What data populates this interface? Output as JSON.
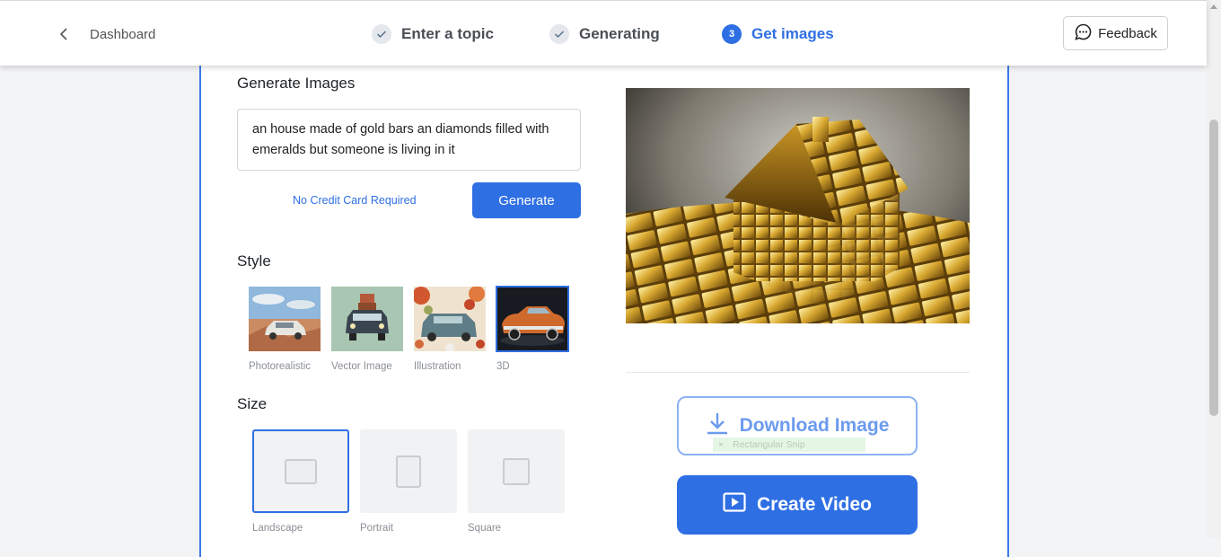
{
  "header": {
    "back_label": "Dashboard",
    "steps": [
      {
        "label": "Enter a topic",
        "state": "done"
      },
      {
        "label": "Generating",
        "state": "done"
      },
      {
        "label": "Get images",
        "number": "3",
        "state": "active"
      }
    ],
    "feedback_label": "Feedback"
  },
  "generate": {
    "title": "Generate Images",
    "prompt": "an house made of gold bars an diamonds filled with emeralds but someone is living in it",
    "no_credit_card": "No Credit Card Required",
    "button_label": "Generate"
  },
  "style": {
    "title": "Style",
    "options": [
      {
        "label": "Photorealistic",
        "selected": false
      },
      {
        "label": "Vector Image",
        "selected": false
      },
      {
        "label": "Illustration",
        "selected": false
      },
      {
        "label": "3D",
        "selected": true
      }
    ]
  },
  "size": {
    "title": "Size",
    "options": [
      {
        "label": "Landscape",
        "selected": true
      },
      {
        "label": "Portrait",
        "selected": false
      },
      {
        "label": "Square",
        "selected": false
      }
    ]
  },
  "actions": {
    "download_label": "Download Image",
    "create_video_label": "Create Video",
    "snip_overlay": "Rectangular Snip"
  },
  "colors": {
    "accent": "#2f6fe4",
    "card_border": "#3b7be9"
  }
}
